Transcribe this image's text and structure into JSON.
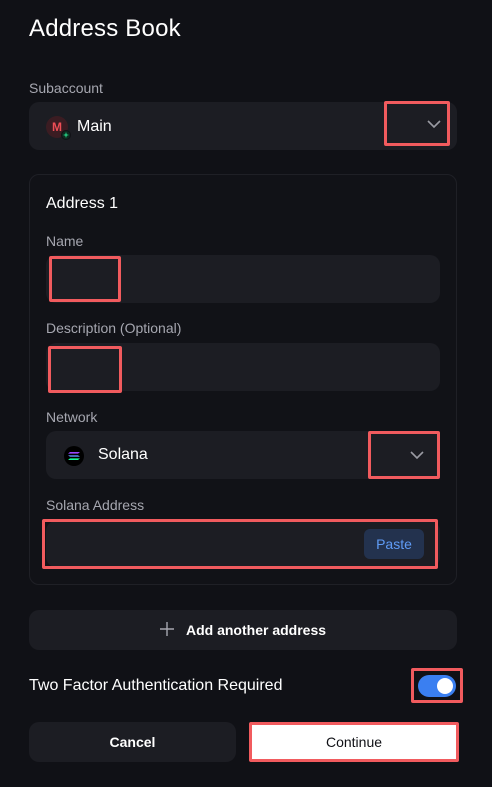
{
  "page": {
    "title": "Address Book"
  },
  "subaccount": {
    "label": "Subaccount",
    "avatar_letter": "M",
    "selected": "Main",
    "chevron_icon": "chevron-down-icon"
  },
  "address_card": {
    "title": "Address 1",
    "name": {
      "label": "Name",
      "value": ""
    },
    "description": {
      "label": "Description (Optional)",
      "value": ""
    },
    "network": {
      "label": "Network",
      "selected": "Solana",
      "icon": "solana-icon",
      "chevron_icon": "chevron-down-icon"
    },
    "address": {
      "label": "Solana Address",
      "value": "",
      "paste_label": "Paste"
    }
  },
  "add_address": {
    "icon": "plus-icon",
    "label": "Add another address"
  },
  "two_factor": {
    "label": "Two Factor Authentication Required",
    "enabled": true
  },
  "actions": {
    "cancel_label": "Cancel",
    "continue_label": "Continue"
  },
  "colors": {
    "background": "#101116",
    "field": "#1c1d23",
    "accent": "#3a7ff1",
    "highlight": "#f15b5e"
  }
}
